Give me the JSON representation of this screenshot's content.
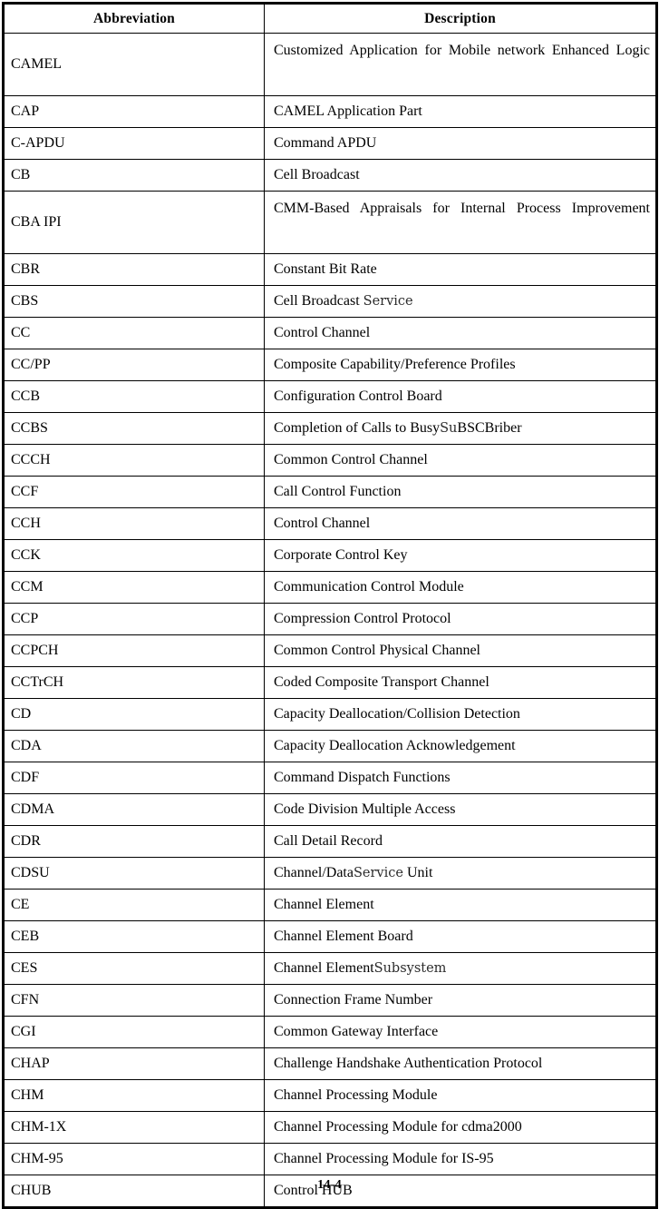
{
  "document": {
    "page_number": "14-4"
  },
  "table": {
    "headers": {
      "abbreviation": "Abbreviation",
      "description": "Description"
    },
    "rows": [
      {
        "abbr": "CAMEL",
        "desc": "Customized Application for Mobile network Enhanced Logic",
        "tall": true
      },
      {
        "abbr": "CAP",
        "desc": "CAMEL Application Part",
        "tall": false
      },
      {
        "abbr": "C-APDU",
        "desc": "Command APDU",
        "tall": false
      },
      {
        "abbr": "CB",
        "desc": "Cell Broadcast",
        "tall": false
      },
      {
        "abbr": "CBA IPI",
        "desc": "CMM-Based Appraisals for Internal Process Improvement",
        "tall": true
      },
      {
        "abbr": "CBR",
        "desc": "Constant Bit Rate",
        "tall": false
      },
      {
        "abbr": "CBS",
        "desc": "Cell Broadcast Service",
        "tall": false,
        "alt_run": "Service"
      },
      {
        "abbr": "CC",
        "desc": "Control Channel",
        "tall": false
      },
      {
        "abbr": "CC/PP",
        "desc": "Composite Capability/Preference Profiles",
        "tall": false
      },
      {
        "abbr": "CCB",
        "desc": "Configuration Control Board",
        "tall": false
      },
      {
        "abbr": "CCBS",
        "desc": "Completion of Calls to BusySuBSCBriber",
        "tall": false,
        "alt_run": "Su"
      },
      {
        "abbr": "CCCH",
        "desc": "Common Control Channel",
        "tall": false
      },
      {
        "abbr": "CCF",
        "desc": "Call Control Function",
        "tall": false
      },
      {
        "abbr": "CCH",
        "desc": "Control Channel",
        "tall": false
      },
      {
        "abbr": "CCK",
        "desc": "Corporate Control Key",
        "tall": false
      },
      {
        "abbr": "CCM",
        "desc": "Communication Control Module",
        "tall": false
      },
      {
        "abbr": "CCP",
        "desc": "Compression Control Protocol",
        "tall": false
      },
      {
        "abbr": "CCPCH",
        "desc": "Common Control Physical Channel",
        "tall": false
      },
      {
        "abbr": "CCTrCH",
        "desc": "Coded Composite Transport Channel",
        "tall": false
      },
      {
        "abbr": "CD",
        "desc": "Capacity Deallocation/Collision Detection",
        "tall": false
      },
      {
        "abbr": "CDA",
        "desc": "Capacity Deallocation Acknowledgement",
        "tall": false
      },
      {
        "abbr": "CDF",
        "desc": "Command Dispatch Functions",
        "tall": false
      },
      {
        "abbr": "CDMA",
        "desc": "Code Division Multiple Access",
        "tall": false
      },
      {
        "abbr": "CDR",
        "desc": "Call Detail Record",
        "tall": false
      },
      {
        "abbr": "CDSU",
        "desc": "Channel/DataService Unit",
        "tall": false,
        "alt_run": "Service"
      },
      {
        "abbr": "CE",
        "desc": "Channel Element",
        "tall": false
      },
      {
        "abbr": "CEB",
        "desc": "Channel Element Board",
        "tall": false
      },
      {
        "abbr": "CES",
        "desc": "Channel ElementSubsystem",
        "tall": false,
        "alt_run": "Subsystem"
      },
      {
        "abbr": "CFN",
        "desc": "Connection Frame Number",
        "tall": false
      },
      {
        "abbr": "CGI",
        "desc": "Common Gateway Interface",
        "tall": false
      },
      {
        "abbr": "CHAP",
        "desc": "Challenge Handshake Authentication Protocol",
        "tall": false
      },
      {
        "abbr": "CHM",
        "desc": "Channel Processing Module",
        "tall": false
      },
      {
        "abbr": "CHM-1X",
        "desc": "Channel Processing Module for cdma2000",
        "tall": false
      },
      {
        "abbr": "CHM-95",
        "desc": "Channel Processing Module for IS-95",
        "tall": false
      },
      {
        "abbr": "CHUB",
        "desc": "Control HUB",
        "tall": false
      }
    ]
  }
}
